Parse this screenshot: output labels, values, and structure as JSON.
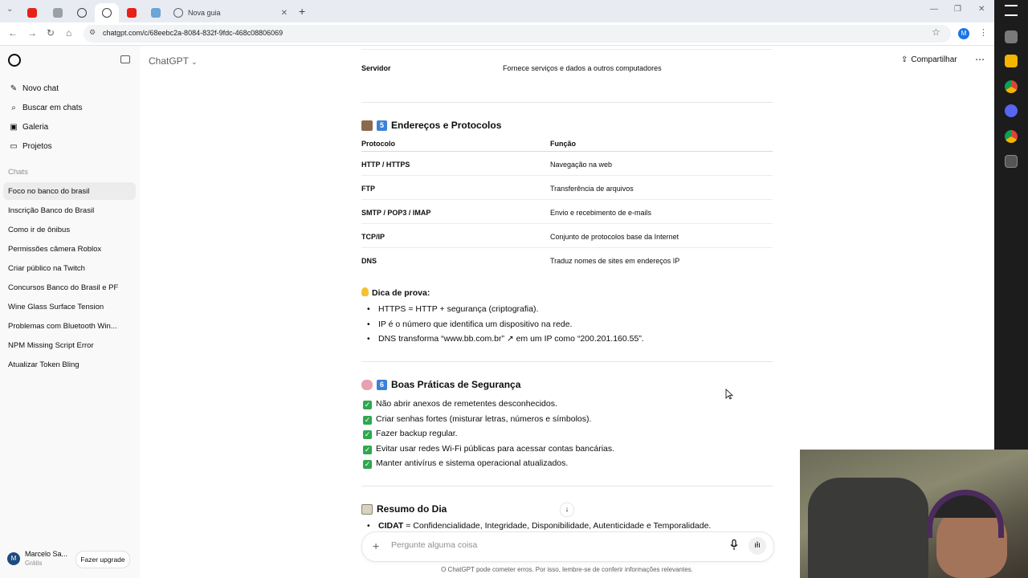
{
  "browser": {
    "tabs": [
      {
        "title": "",
        "active": false
      },
      {
        "title": "",
        "active": false
      },
      {
        "title": "",
        "active": false
      },
      {
        "title": "",
        "active": true
      },
      {
        "title": "",
        "active": false
      },
      {
        "title": "",
        "active": false
      },
      {
        "title": "Nova guia",
        "active": false
      }
    ],
    "url": "chatgpt.com/c/68eebc2a-8084-832f-9fdc-468c08806069",
    "profile_initial": "M"
  },
  "sidebar": {
    "actions": [
      {
        "icon": "edit-icon",
        "label": "Novo chat"
      },
      {
        "icon": "search-icon",
        "label": "Buscar em chats"
      },
      {
        "icon": "image-icon",
        "label": "Galeria"
      },
      {
        "icon": "folder-icon",
        "label": "Projetos"
      }
    ],
    "section_label": "Chats",
    "chats": [
      "Foco no banco do brasil",
      "Inscrição Banco do Brasil",
      "Como ir de ônibus",
      "Permissões câmera Roblox",
      "Criar público na Twitch",
      "Concursos Banco do Brasil e PF",
      "Wine Glass Surface Tension",
      "Problemas com Bluetooth Win...",
      "NPM Missing Script Error",
      "Atualizar Token Bling"
    ],
    "user": {
      "initial": "M",
      "name": "Marcelo Sa...",
      "plan": "Grátis",
      "upgrade_label": "Fazer upgrade"
    }
  },
  "header": {
    "title": "ChatGPT",
    "share_label": "Compartilhar"
  },
  "content": {
    "prev_row": {
      "term": "Servidor",
      "desc": "Fornece serviços e dados a outros computadores"
    },
    "section5": {
      "number": "5",
      "title": "Endereços e Protocolos",
      "columns": [
        "Protocolo",
        "Função"
      ],
      "rows": [
        [
          "HTTP / HTTPS",
          "Navegação na web"
        ],
        [
          "FTP",
          "Transferência de arquivos"
        ],
        [
          "SMTP / POP3 / IMAP",
          "Envio e recebimento de e-mails"
        ],
        [
          "TCP/IP",
          "Conjunto de protocolos base da Internet"
        ],
        [
          "DNS",
          "Traduz nomes de sites em endereços IP"
        ]
      ]
    },
    "tip": {
      "title": "Dica de prova:",
      "items": [
        "HTTPS = HTTP + segurança (criptografia).",
        "IP é o número que identifica um dispositivo na rede.",
        "DNS transforma “www.bb.com.br” ↗ em um IP como “200.201.160.55”."
      ]
    },
    "section6": {
      "number": "6",
      "title": "Boas Práticas de Segurança",
      "items": [
        "Não abrir anexos de remetentes desconhecidos.",
        "Criar senhas fortes (misturar letras, números e símbolos).",
        "Fazer backup regular.",
        "Evitar usar redes Wi-Fi públicas para acessar contas bancárias.",
        "Manter antivírus e sistema operacional atualizados."
      ]
    },
    "summary": {
      "title": "Resumo do Dia",
      "first_item_bold": "CIDAT",
      "first_item_rest": " = Confidencialidade, Integridade, Disponibilidade, Autenticidade e Temporalidade."
    }
  },
  "composer": {
    "placeholder": "Pergunte alguma coisa",
    "disclaimer": "O ChatGPT pode cometer erros. Por isso, lembre-se de conferir informações relevantes."
  },
  "colors": {
    "accent": "#3b82d6",
    "check": "#2fa84f",
    "sidebar_bg": "#f9f9f9"
  }
}
